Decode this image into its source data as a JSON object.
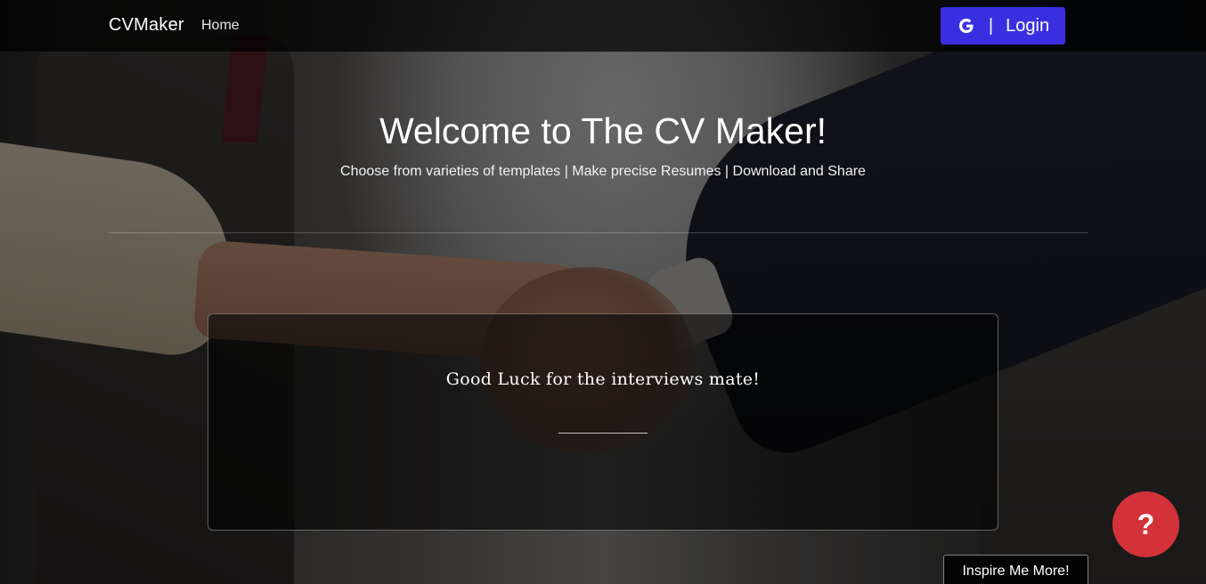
{
  "navbar": {
    "brand": "CVMaker",
    "home_label": "Home",
    "login_label": "Login",
    "login_separator": "|",
    "login_icon": "google-icon",
    "login_color": "#3a2fe0"
  },
  "hero": {
    "title": "Welcome to The CV Maker!",
    "subtitle": "Choose from varieties of templates | Make precise Resumes | Download and Share"
  },
  "quote_card": {
    "text": "Good Luck for the interviews mate!"
  },
  "help_button": {
    "label": "?",
    "color": "#d3323a"
  },
  "inspire_button": {
    "label": "Inspire Me More!"
  }
}
